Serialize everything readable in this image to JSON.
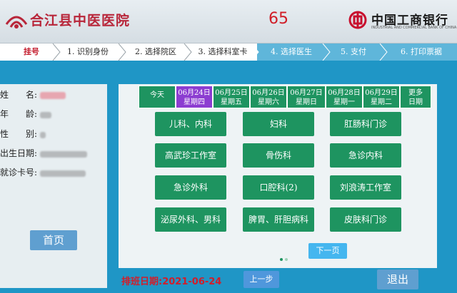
{
  "header": {
    "hospital_name": "合江县中医医院",
    "countdown": "65",
    "bank_name": "中国工商银行",
    "bank_subtitle": "INDUSTRIAL AND COMMERCIAL BANK OF CHINA",
    "brand_color": "#b8263a"
  },
  "steps": [
    {
      "label": "挂号",
      "state": "active"
    },
    {
      "label": "1. 识别身份",
      "state": "done"
    },
    {
      "label": "2. 选择院区",
      "state": "done"
    },
    {
      "label": "3. 选择科室卡",
      "state": "done"
    },
    {
      "label": "4. 选择医生",
      "state": "future"
    },
    {
      "label": "5. 支付",
      "state": "future"
    },
    {
      "label": "6. 打印票据",
      "state": "future"
    }
  ],
  "patient": {
    "name_label": "姓　　名:",
    "age_label": "年　　龄:",
    "gender_label": "性　　别:",
    "birth_label": "出生日期:",
    "card_label": "就诊卡号:"
  },
  "dates": [
    {
      "line1": "今天",
      "line2": "",
      "selected": false
    },
    {
      "line1": "06月24日",
      "line2": "星期四",
      "selected": true
    },
    {
      "line1": "06月25日",
      "line2": "星期五",
      "selected": false
    },
    {
      "line1": "06月26日",
      "line2": "星期六",
      "selected": false
    },
    {
      "line1": "06月27日",
      "line2": "星期日",
      "selected": false
    },
    {
      "line1": "06月28日",
      "line2": "星期一",
      "selected": false
    },
    {
      "line1": "06月29日",
      "line2": "星期二",
      "selected": false
    },
    {
      "line1": "更多",
      "line2": "日期",
      "selected": false
    }
  ],
  "departments": [
    "儿科、内科",
    "妇科",
    "肛肠科门诊",
    "高武珍工作室",
    "骨伤科",
    "急诊内科",
    "急诊外科",
    "口腔科(2)",
    "刘浪涛工作室",
    "泌尿外科、男科",
    "脾胃、肝胆病科",
    "皮肤科门诊"
  ],
  "pager": {
    "next_label": "下一页",
    "prev_label": "上一步"
  },
  "schedule_date": "排班日期:2021-06-24",
  "home_label": "首页",
  "exit_label": "退出"
}
